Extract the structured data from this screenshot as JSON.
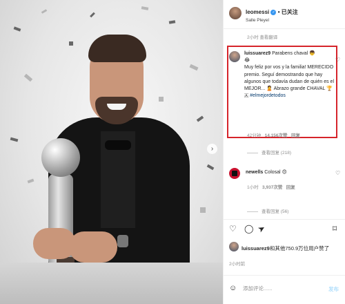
{
  "post": {
    "user": "leomessi",
    "verified_mark": "✓",
    "separator": "•",
    "follow_status": "已关注",
    "location": "Salle Pleyel",
    "more_icon": "more-icon",
    "nav_next_icon": "chevron-right-icon"
  },
  "comments_prev_cut": "2小时  查看翻译",
  "highlighted_comment": {
    "user": "luissuarez9",
    "text_line1": "Parabens chaval",
    "emoji1": "👦",
    "emoji2": "😂",
    "body": "Muy feliz por vos y la familia! MERECIDO premio. Seguí demostrando que hay algunos que todavía dudan de quién es el MEJOR...",
    "emoji3": "🙎",
    "body2": "Abrazo grande CHAVAL",
    "emoji4": "🏆",
    "emoji5": "🇦",
    "hashtag": "#elmejordetodos",
    "time": "42分钟",
    "likes": "14,156次赞",
    "reply": "回复",
    "view_replies": "查看回复 (218)"
  },
  "second_comment": {
    "user": "newells",
    "text": "Colosal",
    "emoji": "😍",
    "time": "1小时",
    "likes": "3,937次赞",
    "reply": "回复",
    "view_replies": "查看回复 (56)"
  },
  "likes_summary": {
    "user": "luissuarez9",
    "rest": "和其他750.9万位用户赞了"
  },
  "time_ago": "2小时前",
  "add_comment": {
    "placeholder": "添加评论......",
    "post_label": "发布"
  },
  "icons": {
    "heart": "♡",
    "comment": "◯",
    "share": "➤",
    "save": "⌑",
    "emoji": "☺",
    "nav_next": "›"
  }
}
